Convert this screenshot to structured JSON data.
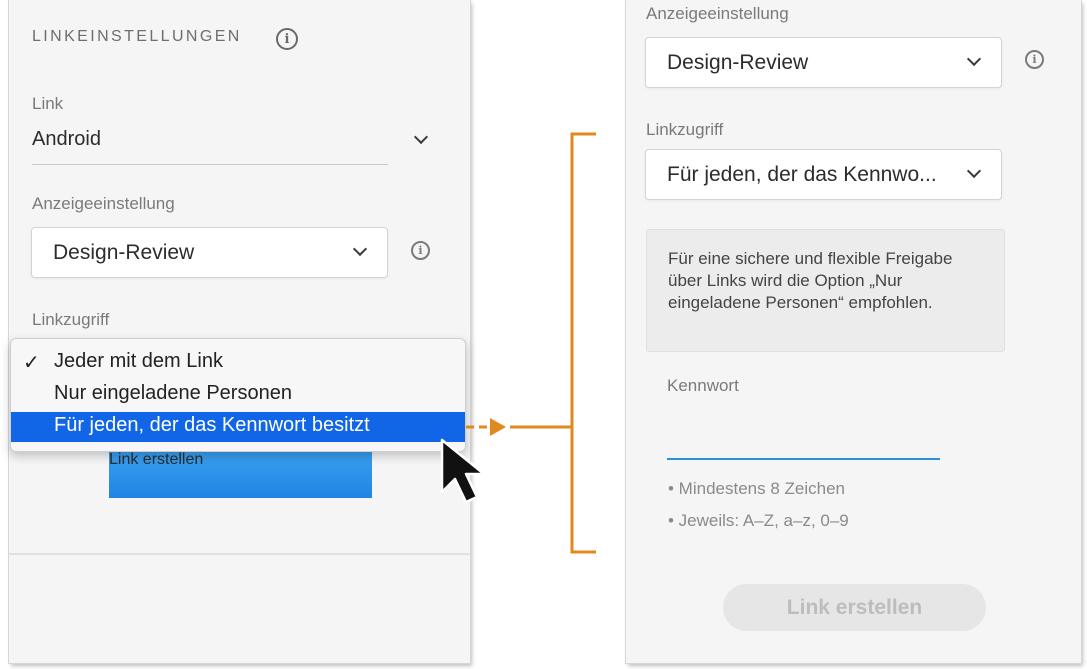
{
  "left_panel": {
    "section_title": "LINKEINSTELLUNGEN",
    "link_label": "Link",
    "link_value": "Android",
    "view_setting_label": "Anzeigeeinstellung",
    "view_setting_value": "Design-Review",
    "access_label": "Linkzugriff",
    "dropdown_items": [
      {
        "check": "✓",
        "label": "Jeder mit dem Link"
      },
      {
        "check": "",
        "label": "Nur eingeladene Personen"
      },
      {
        "check": "",
        "label": "Für jeden, der das Kennwort besitzt"
      }
    ],
    "create_button": "Link erstellen"
  },
  "right_panel": {
    "view_setting_label": "Anzeigeeinstellung",
    "view_setting_value": "Design-Review",
    "access_label": "Linkzugriff",
    "access_value": "Für jeden, der das Kennwo...",
    "info_text": "Für eine sichere und flexible Freigabe über Links wird die Option „Nur eingeladene Personen“ empfohlen.",
    "password_label": "Kennwort",
    "password_value": "",
    "hints": [
      "• Mindestens 8 Zeichen",
      "• Jeweils: A–Z, a–z, 0–9"
    ],
    "create_button": "Link erstellen"
  },
  "colors": {
    "accent_blue": "#1066e6",
    "button_blue": "#2a8fe9",
    "annotation_orange": "#e08a1e",
    "input_focus": "#2a90d9"
  },
  "icons": [
    "info-icon",
    "chevron-down-icon",
    "checkmark-icon",
    "mouse-cursor-icon",
    "arrow-right-icon"
  ]
}
